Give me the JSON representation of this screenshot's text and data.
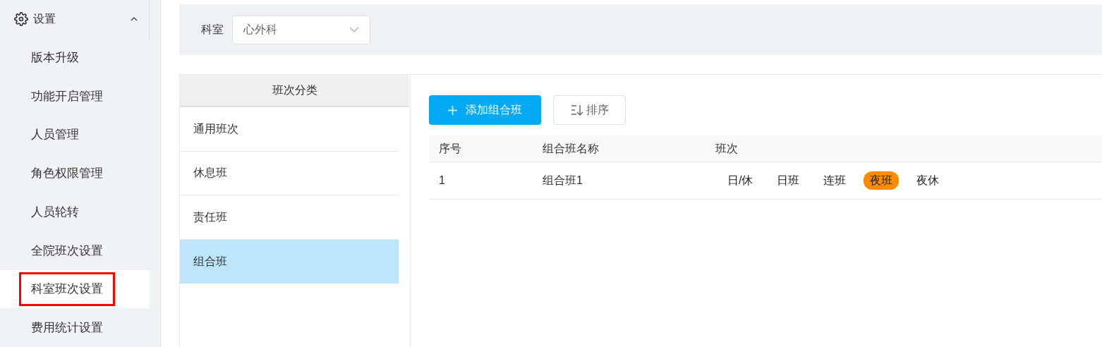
{
  "sidebar": {
    "header": {
      "label": "设置",
      "expanded": true
    },
    "items": [
      {
        "label": "版本升级",
        "selected": false,
        "marked": false
      },
      {
        "label": "功能开启管理",
        "selected": false,
        "marked": false
      },
      {
        "label": "人员管理",
        "selected": false,
        "marked": false
      },
      {
        "label": "角色权限管理",
        "selected": false,
        "marked": false
      },
      {
        "label": "人员轮转",
        "selected": false,
        "marked": false
      },
      {
        "label": "全院班次设置",
        "selected": false,
        "marked": false
      },
      {
        "label": "科室班次设置",
        "selected": true,
        "marked": true
      },
      {
        "label": "费用统计设置",
        "selected": false,
        "marked": false
      }
    ]
  },
  "filter": {
    "label": "科室",
    "value": "心外科"
  },
  "categories": {
    "title": "班次分类",
    "items": [
      {
        "label": "通用班次",
        "selected": false
      },
      {
        "label": "休息班",
        "selected": false
      },
      {
        "label": "责任班",
        "selected": false
      },
      {
        "label": "组合班",
        "selected": true
      }
    ]
  },
  "toolbar": {
    "add_button": "添加组合班",
    "sort_button": "排序"
  },
  "table": {
    "columns": [
      "序号",
      "组合班名称",
      "班次"
    ],
    "rows": [
      {
        "index": "1",
        "name": "组合班1",
        "shifts": [
          {
            "label": "日/休",
            "highlighted": false
          },
          {
            "label": "日班",
            "highlighted": false
          },
          {
            "label": "连班",
            "highlighted": false
          },
          {
            "label": "夜班",
            "highlighted": true
          },
          {
            "label": "夜休",
            "highlighted": false
          }
        ]
      }
    ]
  }
}
